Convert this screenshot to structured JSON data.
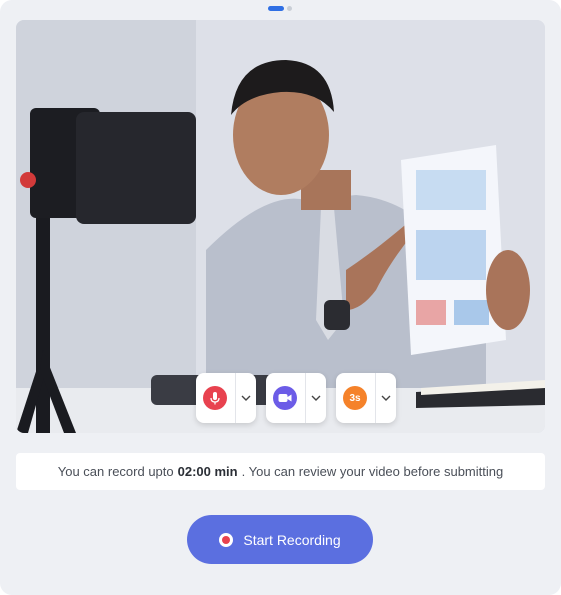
{
  "pager": {
    "active_index": 0,
    "count": 2
  },
  "video": {
    "preview_alt": "camera-preview"
  },
  "controls": {
    "mic": {
      "icon": "microphone-icon",
      "color": "#e8424f"
    },
    "camera": {
      "icon": "video-camera-icon",
      "color": "#6c5ce7"
    },
    "timer": {
      "icon": "timer-icon",
      "label": "3s",
      "color": "#f5822a"
    }
  },
  "info": {
    "prefix": "You can record upto",
    "duration": "02:00 min",
    "suffix": ". You can review your video before submitting"
  },
  "record_button": {
    "label": "Start Recording",
    "icon": "record-icon",
    "color": "#5b6fe0"
  }
}
